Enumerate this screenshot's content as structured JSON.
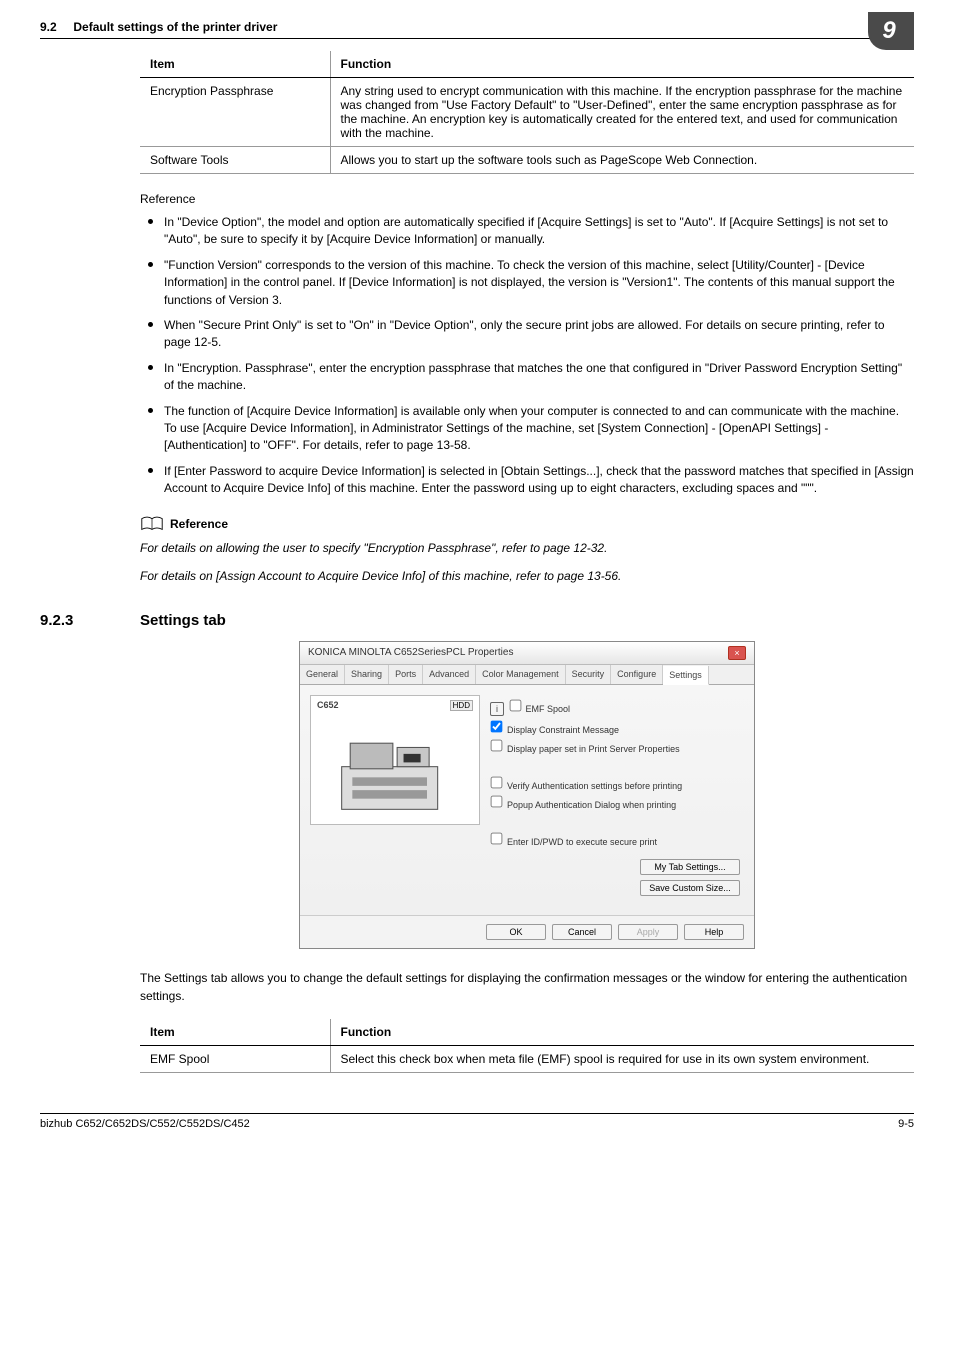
{
  "header": {
    "section_number": "9.2",
    "section_title": "Default settings of the printer driver",
    "chapter_badge": "9"
  },
  "table1": {
    "head_item": "Item",
    "head_function": "Function",
    "rows": [
      {
        "item": "Encryption Passphrase",
        "function": "Any string used to encrypt communication with this machine.\nIf the encryption passphrase for the machine was changed from \"Use Factory Default\" to \"User-Defined\", enter the same encryption passphrase as for the machine. An encryption key is automatically created for the entered text, and used for communication with the machine."
      },
      {
        "item": "Software Tools",
        "function": "Allows you to start up the software tools such as PageScope Web Connection."
      }
    ]
  },
  "reference_label": "Reference",
  "reference_items": [
    "In \"Device Option\", the model and option are automatically specified if [Acquire Settings] is set to \"Auto\". If [Acquire Settings] is not set to \"Auto\", be sure to specify it by [Acquire Device Information] or manually.",
    "\"Function Version\" corresponds to the version of this machine. To check the version of this machine, select [Utility/Counter] - [Device Information] in the control panel. If [Device Information] is not displayed, the version is \"Version1\". The contents of this manual support the functions of Version 3.",
    "When \"Secure Print Only\" is set to \"On\" in \"Device Option\", only the secure print jobs are allowed. For details on secure printing, refer to page 12-5.",
    "In \"Encryption. Passphrase\", enter the encryption passphrase that matches the one that configured in \"Driver Password Encryption Setting\" of the machine.",
    "The function of [Acquire Device Information] is available only when your computer is connected to and can communicate with the machine. To use [Acquire Device Information], in Administrator Settings of the machine, set [System Connection] - [OpenAPI Settings] - [Authentication] to \"OFF\". For details, refer to page 13-58.",
    "If [Enter Password to acquire Device Information] is selected in [Obtain Settings...], check that the password matches that specified in [Assign Account to Acquire Device Info] of this machine. Enter the password using up to eight characters, excluding spaces and \"\"\"."
  ],
  "ref_block": {
    "title": "Reference",
    "line1": "For details on allowing the user to specify \"Encryption Passphrase\", refer to page 12-32.",
    "line2": "For details on [Assign Account to Acquire Device Info] of this machine, refer to page 13-56."
  },
  "subsection": {
    "number": "9.2.3",
    "title": "Settings tab"
  },
  "dialog": {
    "title": "KONICA MINOLTA C652SeriesPCL Properties",
    "tabs": [
      "General",
      "Sharing",
      "Ports",
      "Advanced",
      "Color Management",
      "Security",
      "Configure",
      "Settings"
    ],
    "active_tab": "Settings",
    "preview_label": "C652",
    "hdd_label": "HDD",
    "info_i": "i",
    "checks": [
      {
        "label": "EMF Spool",
        "checked": false
      },
      {
        "label": "Display Constraint Message",
        "checked": true
      },
      {
        "label": "Display paper set in Print Server Properties",
        "checked": false
      }
    ],
    "checks2": [
      {
        "label": "Verify Authentication settings before printing",
        "checked": false
      },
      {
        "label": "Popup Authentication Dialog when printing",
        "checked": false
      }
    ],
    "checks3": [
      {
        "label": "Enter ID/PWD to execute secure print",
        "checked": false
      }
    ],
    "side_buttons": [
      "My Tab Settings...",
      "Save Custom Size..."
    ],
    "bottom_buttons": {
      "ok": "OK",
      "cancel": "Cancel",
      "apply": "Apply",
      "help": "Help"
    }
  },
  "settings_desc": "The Settings tab allows you to change the default settings for displaying the confirmation messages or the window for entering the authentication settings.",
  "table2": {
    "head_item": "Item",
    "head_function": "Function",
    "rows": [
      {
        "item": "EMF Spool",
        "function": "Select this check box when meta file (EMF) spool is required for use in its own system environment."
      }
    ]
  },
  "footer": {
    "left": "bizhub C652/C652DS/C552/C552DS/C452",
    "right": "9-5"
  }
}
